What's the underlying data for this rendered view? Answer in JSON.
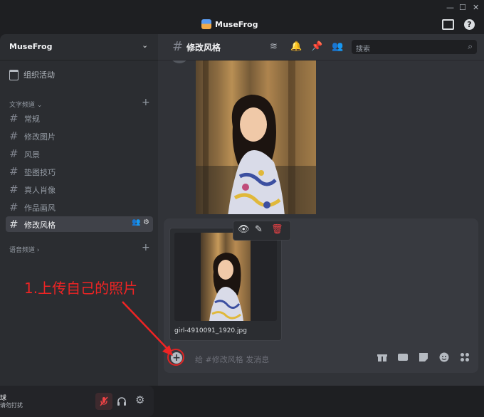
{
  "app": {
    "title": "MuseFrog"
  },
  "server": {
    "name": "MuseFrog",
    "events_label": "组织活动"
  },
  "categories": {
    "text": "文字频道",
    "voice": "语音频道"
  },
  "channels": [
    {
      "name": "常规",
      "active": false
    },
    {
      "name": "修改图片",
      "active": false
    },
    {
      "name": "风景",
      "active": false
    },
    {
      "name": "垫图技巧",
      "active": false
    },
    {
      "name": "真人肖像",
      "active": false
    },
    {
      "name": "作品画风",
      "active": false
    },
    {
      "name": "修改风格",
      "active": true
    }
  ],
  "header": {
    "channel": "修改风格",
    "search_placeholder": "搜索"
  },
  "user": {
    "name": "球",
    "status": "请勿打扰"
  },
  "attachment": {
    "filename": "girl-4910091_1920.jpg"
  },
  "composer": {
    "placeholder": "给 #修改风格 发消息"
  },
  "annotation": {
    "text": "1.上传自己的照片"
  },
  "colors": {
    "annotation": "#ee2424",
    "active_channel_bg": "#404249",
    "delete": "#ed4245"
  }
}
